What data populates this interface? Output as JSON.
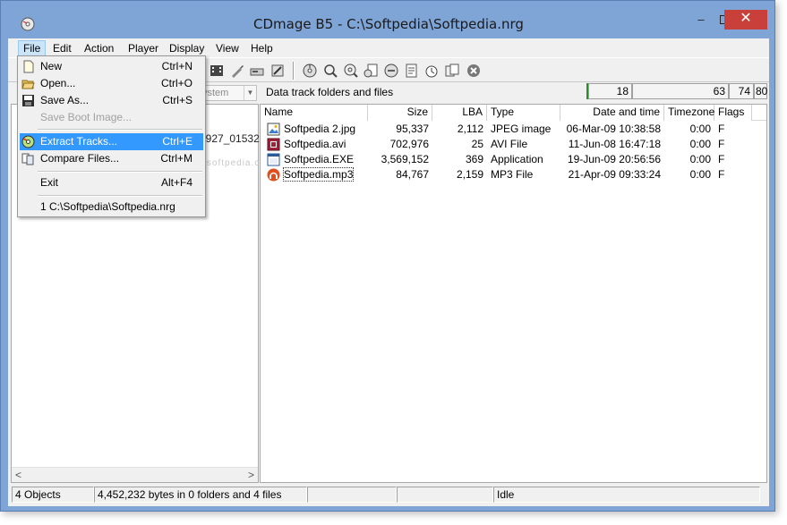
{
  "window": {
    "title": "CDmage B5 - C:\\Softpedia\\Softpedia.nrg",
    "min_glyph": "–",
    "max_glyph": "□",
    "close_glyph": "✕"
  },
  "menubar": {
    "items": [
      "File",
      "Edit",
      "Action",
      "Player",
      "Display",
      "View",
      "Help"
    ]
  },
  "file_menu": {
    "items": [
      {
        "label": "New",
        "shortcut": "Ctrl+N",
        "icon": "new-document-icon"
      },
      {
        "label": "Open...",
        "shortcut": "Ctrl+O",
        "icon": "open-folder-icon"
      },
      {
        "label": "Save As...",
        "shortcut": "Ctrl+S",
        "icon": "save-icon"
      },
      {
        "label": "Save Boot Image...",
        "shortcut": "",
        "icon": ""
      },
      {
        "label": "Extract Tracks...",
        "shortcut": "Ctrl+E",
        "icon": "extract-disc-icon"
      },
      {
        "label": "Compare Files...",
        "shortcut": "Ctrl+M",
        "icon": "compare-files-icon"
      },
      {
        "label": "Exit",
        "shortcut": "Alt+F4",
        "icon": ""
      },
      {
        "label": "1 C:\\Softpedia\\Softpedia.nrg",
        "shortcut": "",
        "icon": ""
      }
    ]
  },
  "left_panel": {
    "combo_text": "ystem",
    "tree_text": "0927_01532",
    "watermark": "www.softpedia.com",
    "scroll_left": "<",
    "scroll_right": ">"
  },
  "right_panel": {
    "header_label": "Data track folders and files",
    "box_values": [
      "18",
      "63",
      "74",
      "80"
    ]
  },
  "file_list": {
    "columns": [
      "Name",
      "Size",
      "LBA",
      "Type",
      "Date and time",
      "Timezone",
      "Flags"
    ],
    "rows": [
      {
        "name": "Softpedia 2.jpg",
        "size": "95,337",
        "lba": "2,112",
        "type": "JPEG image",
        "date": "06-Mar-09 10:38:58",
        "tz": "0:00",
        "flags": "F",
        "icon": "image-file-icon"
      },
      {
        "name": "Softpedia.avi",
        "size": "702,976",
        "lba": "25",
        "type": "AVI File",
        "date": "11-Jun-08 16:47:18",
        "tz": "0:00",
        "flags": "F",
        "icon": "video-file-icon"
      },
      {
        "name": "Softpedia.EXE",
        "size": "3,569,152",
        "lba": "369",
        "type": "Application",
        "date": "19-Jun-09 20:56:56",
        "tz": "0:00",
        "flags": "F",
        "icon": "application-file-icon"
      },
      {
        "name": "Softpedia.mp3",
        "size": "84,767",
        "lba": "2,159",
        "type": "MP3 File",
        "date": "21-Apr-09 09:33:24",
        "tz": "0:00",
        "flags": "F",
        "icon": "audio-file-icon"
      }
    ]
  },
  "statusbar": {
    "objects": "4 Objects",
    "summary": "4,452,232 bytes in 0 folders and 4 files",
    "empty1": "",
    "empty2": "",
    "state": "Idle"
  }
}
